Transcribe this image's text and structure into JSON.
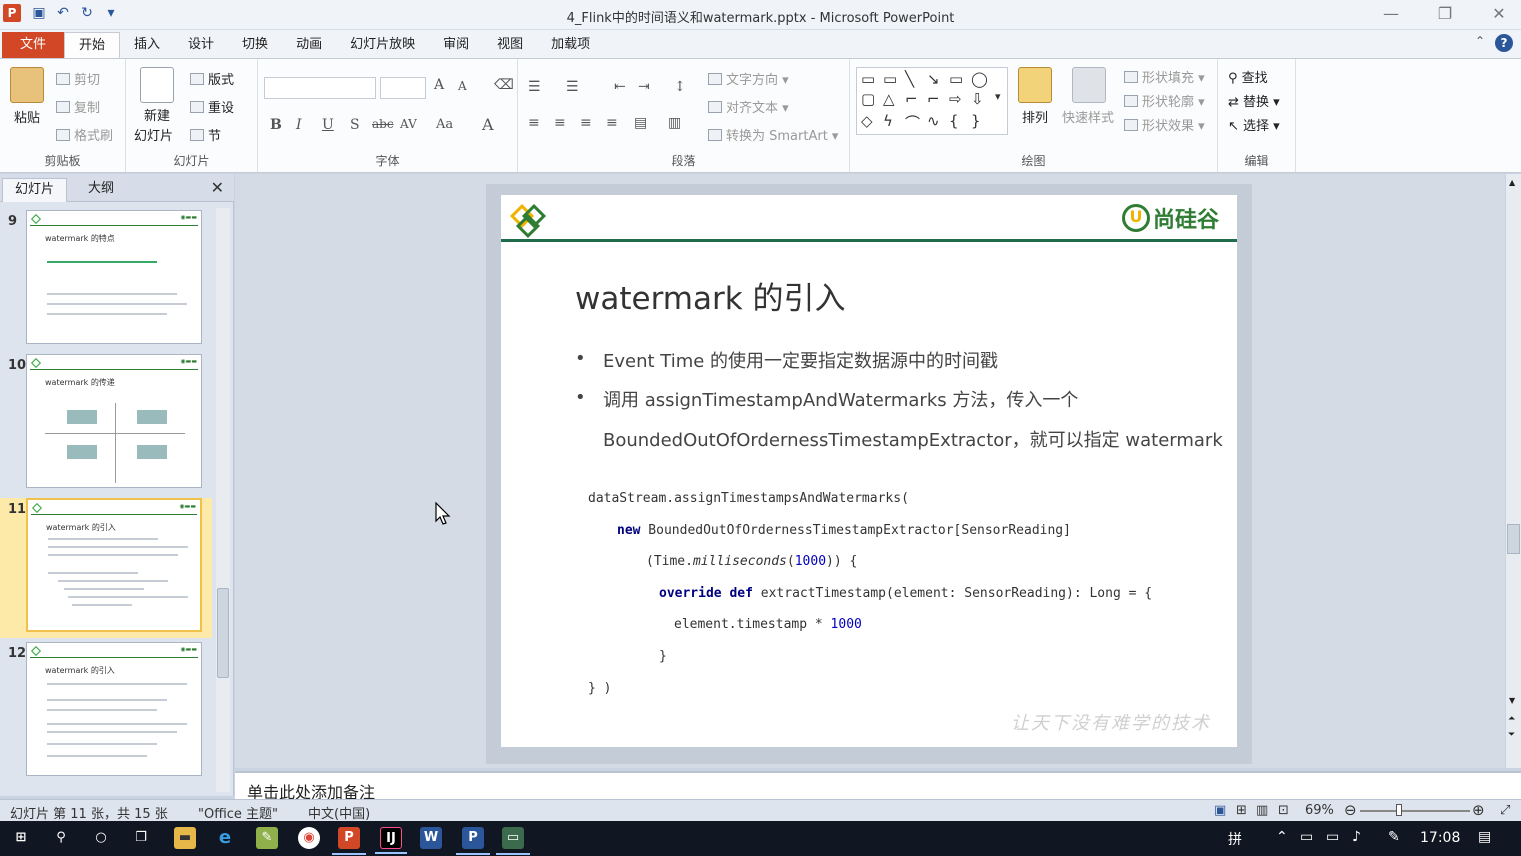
{
  "window": {
    "title": "4_Flink中的时间语义和watermark.pptx - Microsoft PowerPoint",
    "app_icon": "P",
    "controls": [
      "minimize-icon",
      "restore-icon",
      "close-icon"
    ]
  },
  "tabs": [
    "文件",
    "开始",
    "插入",
    "设计",
    "切换",
    "动画",
    "幻灯片放映",
    "审阅",
    "视图",
    "加载项"
  ],
  "active_tab": "开始",
  "ribbon": {
    "clipboard": {
      "paste": "粘贴",
      "cut": "剪切",
      "copy": "复制",
      "format_painter": "格式刷",
      "label": "剪贴板"
    },
    "slides": {
      "new_slide_1": "新建",
      "new_slide_2": "幻灯片",
      "layout": "版式",
      "reset": "重设",
      "section": "节",
      "label": "幻灯片"
    },
    "font": {
      "label": "字体",
      "bold": "B",
      "italic": "I",
      "underline": "U",
      "shadow": "S",
      "strike": "abc",
      "spacing": "AV",
      "case": "Aa",
      "color": "A",
      "grow": "A",
      "shrink": "A"
    },
    "paragraph": {
      "text_direction": "文字方向",
      "align_text": "对齐文本",
      "smartart": "转换为 SmartArt",
      "label": "段落"
    },
    "drawing": {
      "arrange": "排列",
      "quick_styles": "快速样式",
      "shape_fill": "形状填充",
      "shape_outline": "形状轮廓",
      "shape_effects": "形状效果",
      "label": "绘图"
    },
    "editing": {
      "find": "查找",
      "replace": "替换",
      "select": "选择",
      "label": "编辑"
    }
  },
  "left_panel": {
    "tabs": [
      "幻灯片",
      "大纲"
    ],
    "slides": [
      {
        "num": "9",
        "title": "watermark 的特点"
      },
      {
        "num": "10",
        "title": "watermark 的传递"
      },
      {
        "num": "11",
        "title": "watermark 的引入"
      },
      {
        "num": "12",
        "title": "watermark 的引入"
      }
    ]
  },
  "slide": {
    "logo_text": "尚硅谷",
    "title": "watermark 的引入",
    "bullets": [
      "Event Time 的使用一定要指定数据源中的时间戳",
      "调用 assignTimestampAndWatermarks 方法，传入一个",
      "BoundedOutOfOrdernessTimestampExtractor，就可以指定 watermark"
    ],
    "code": {
      "line1": "dataStream.assignTimestampsAndWatermarks(",
      "line2_kw": "new",
      "line2": " BoundedOutOfOrdernessTimestampExtractor[SensorReading]",
      "line3_a": "(Time.",
      "line3_it": "milliseconds",
      "line3_b": "(",
      "line3_num": "1000",
      "line3_c": ")) {",
      "line4_kw1": "override",
      "line4_kw2": "def",
      "line4": " extractTimestamp(element: SensorReading): Long = {",
      "line5": "element.timestamp * ",
      "line5_num": "1000",
      "line6": "}",
      "line7": "} )"
    },
    "footer": "让天下没有难学的技术"
  },
  "notes_placeholder": "单击此处添加备注",
  "status": {
    "slide_info": "幻灯片 第 11 张，共 15 张",
    "theme": "\"Office 主题\"",
    "language": "中文(中国)",
    "zoom": "69%"
  },
  "taskbar": {
    "time": "17:08",
    "ime": "拼"
  }
}
